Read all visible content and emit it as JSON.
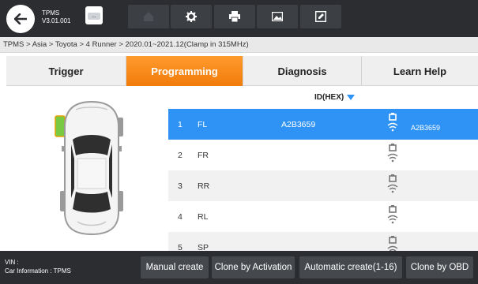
{
  "toolbar": {
    "app_name": "TPMS",
    "app_version": "V3.01.001",
    "buttons": [
      "home-icon",
      "gear-icon",
      "print-icon",
      "screenshot-icon",
      "edit-icon"
    ]
  },
  "breadcrumb": "TPMS > Asia > Toyota > 4 Runner > 2020.01~2021.12(Clamp in 315MHz)",
  "tabs": [
    {
      "label": "Trigger",
      "active": false
    },
    {
      "label": "Programming",
      "active": true
    },
    {
      "label": "Diagnosis",
      "active": false
    },
    {
      "label": "Learn Help",
      "active": false
    }
  ],
  "table": {
    "header_id": "ID(HEX)",
    "rows": [
      {
        "index": "1",
        "position": "FL",
        "hex": "A2B3659",
        "sensor_id": "A2B3659"
      },
      {
        "index": "2",
        "position": "FR",
        "hex": "",
        "sensor_id": ""
      },
      {
        "index": "3",
        "position": "RR",
        "hex": "",
        "sensor_id": ""
      },
      {
        "index": "4",
        "position": "RL",
        "hex": "",
        "sensor_id": ""
      },
      {
        "index": "5",
        "position": "SP",
        "hex": "",
        "sensor_id": ""
      }
    ]
  },
  "footer": {
    "vin_label": "VIN :",
    "car_info": "Car Information : TPMS",
    "buttons": [
      "Manual create",
      "Clone by Activation",
      "Automatic create(1-16)",
      "Clone by OBD"
    ]
  },
  "colors": {
    "accent_orange": "#f07c0a",
    "selected_blue": "#2f93f5",
    "sensor_active": "#7ac943"
  }
}
